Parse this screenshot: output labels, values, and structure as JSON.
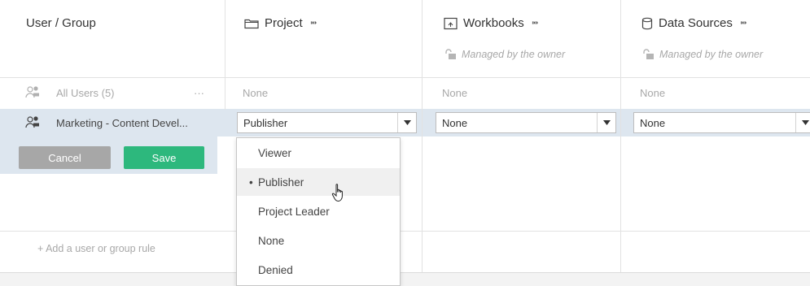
{
  "header": {
    "user_group": "User / Group",
    "project": "Project",
    "workbooks": "Workbooks",
    "data_sources": "Data Sources",
    "expand_glyph": "⁍⁍",
    "managed_text": "Managed by the owner"
  },
  "rows": {
    "all_users": {
      "name": "All Users (5)",
      "more": "···",
      "project": "None",
      "workbooks": "None",
      "data_sources": "None"
    },
    "marketing": {
      "name": "Marketing - Content Devel...",
      "project_select": "Publisher",
      "workbooks_select": "None",
      "data_sources_select": "None"
    }
  },
  "buttons": {
    "cancel": "Cancel",
    "save": "Save"
  },
  "add_rule": "+ Add a user or group rule",
  "menu": {
    "options": [
      "Viewer",
      "Publisher",
      "Project Leader",
      "None",
      "Denied"
    ],
    "selected_marker": "•"
  },
  "colors": {
    "edit_row_bg": "#dde6ef",
    "cancel_bg": "#a7a7a7",
    "save_bg": "#2db87d",
    "menu_highlight": "#f0f0f0"
  }
}
